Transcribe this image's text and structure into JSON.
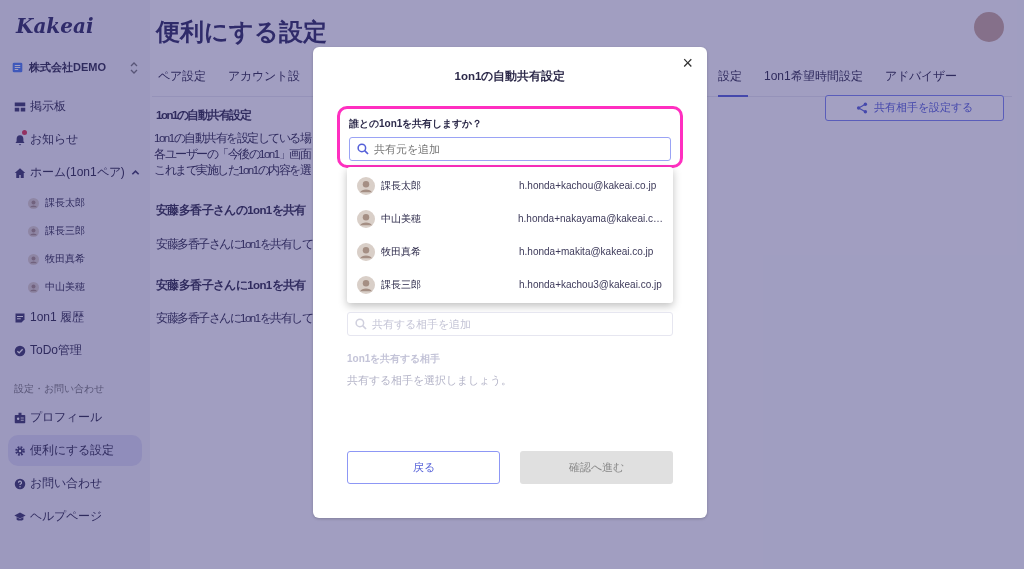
{
  "sidebar": {
    "logo": "Kakeai",
    "company": "株式会社DEMO",
    "items": [
      {
        "kind": "nav",
        "label": "掲示板",
        "selected": false,
        "badge": false
      },
      {
        "kind": "nav",
        "label": "お知らせ",
        "selected": false,
        "badge": true
      },
      {
        "kind": "nav",
        "label": "ホーム(1on1ペア)",
        "selected": false,
        "badge": false,
        "expanded": true,
        "children": [
          {
            "label": "課長太郎",
            "selected": false
          },
          {
            "label": "課長三郎",
            "selected": false
          },
          {
            "label": "牧田真希",
            "selected": false
          },
          {
            "label": "中山美穂",
            "selected": false
          }
        ]
      },
      {
        "kind": "nav",
        "label": "1on1 履歴",
        "selected": false,
        "badge": false
      },
      {
        "kind": "nav",
        "label": "ToDo管理",
        "selected": false,
        "badge": false
      },
      {
        "kind": "section",
        "label": "設定・お問い合わせ"
      },
      {
        "kind": "nav",
        "label": "プロフィール",
        "selected": false,
        "badge": false
      },
      {
        "kind": "nav",
        "label": "便利にする設定",
        "selected": true,
        "badge": false
      },
      {
        "kind": "nav",
        "label": "お問い合わせ",
        "selected": false,
        "badge": false
      },
      {
        "kind": "nav",
        "label": "ヘルプページ",
        "selected": false,
        "badge": false
      }
    ]
  },
  "page": {
    "title": "便利にする設定",
    "tabs": [
      {
        "label": "ペア設定",
        "selected": false
      },
      {
        "label": "アカウント設",
        "selected": false
      },
      {
        "label": "設定",
        "selected": true
      },
      {
        "label": "1on1希望時間設定",
        "selected": false
      },
      {
        "label": "アドバイザー",
        "selected": false
      }
    ],
    "section_title": "1on1の自動共有設定",
    "description_lines": [
      "1on1の自動共有を設定している場",
      "各ユーザーの「今後の1on1」画面",
      "これまで実施した1on1の内容を選"
    ],
    "groups": [
      {
        "heading": "安藤多香子さんの1on1を共有",
        "text": "安藤多香子さんに1on1を共有して"
      },
      {
        "heading": "安藤多香子さんに1on1を共有",
        "text": "安藤多香子さんに1on1を共有して"
      }
    ],
    "share_button": "共有相手を設定する"
  },
  "dialog": {
    "title": "1on1の自動共有設定",
    "close": "×",
    "source": {
      "label": "誰との1on1を共有しますか？",
      "placeholder": "共有元を追加",
      "highlighted": true
    },
    "suggestions": [
      {
        "name": "課長太郎",
        "email": "h.honda+kachou@kakeai.co.jp"
      },
      {
        "name": "中山美穂",
        "email": "h.honda+nakayama@kakeai.c…"
      },
      {
        "name": "牧田真希",
        "email": "h.honda+makita@kakeai.co.jp"
      },
      {
        "name": "課長三郎",
        "email": "h.honda+kachou3@kakeai.co.jp"
      }
    ],
    "target": {
      "placeholder": "共有する相手を追加",
      "label": "1on1を共有する相手",
      "hint": "共有する相手を選択しましょう。",
      "disabled": true
    },
    "buttons": [
      {
        "label": "戻る",
        "disabled": false,
        "kind": "secondary"
      },
      {
        "label": "確認へ進む",
        "disabled": true,
        "kind": "primary"
      }
    ]
  }
}
